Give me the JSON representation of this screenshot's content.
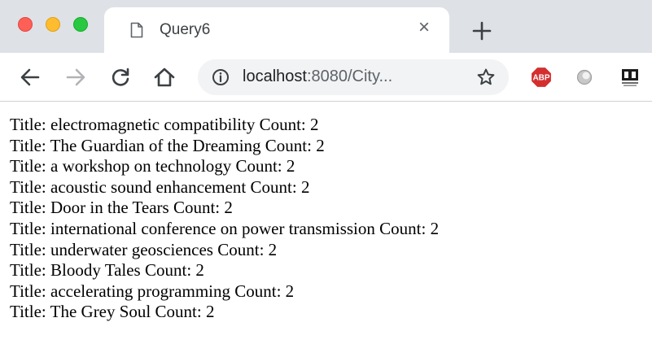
{
  "browser": {
    "tab": {
      "title": "Query6"
    },
    "address_bar": {
      "host": "localhost",
      "rest": ":8080/City..."
    },
    "colors": {
      "tabstrip": "#dee1e6",
      "close_red": "#fe5f57",
      "minimize_yellow": "#febc2e",
      "zoom_green": "#28c840",
      "abp_red": "#d32f2f"
    }
  },
  "results": [
    {
      "label": "Title:",
      "title": "electromagnetic compatibility",
      "count_label": "Count:",
      "count": "2"
    },
    {
      "label": "Title:",
      "title": "The Guardian of the Dreaming",
      "count_label": "Count:",
      "count": "2"
    },
    {
      "label": "Title:",
      "title": "a workshop on technology",
      "count_label": "Count:",
      "count": "2"
    },
    {
      "label": "Title:",
      "title": "acoustic sound enhancement",
      "count_label": "Count:",
      "count": "2"
    },
    {
      "label": "Title:",
      "title": "Door in the Tears",
      "count_label": "Count:",
      "count": "2"
    },
    {
      "label": "Title:",
      "title": "international conference on power transmission",
      "count_label": "Count:",
      "count": "2"
    },
    {
      "label": "Title:",
      "title": "underwater geosciences",
      "count_label": "Count:",
      "count": "2"
    },
    {
      "label": "Title:",
      "title": "Bloody Tales",
      "count_label": "Count:",
      "count": "2"
    },
    {
      "label": "Title:",
      "title": "accelerating programming",
      "count_label": "Count:",
      "count": "2"
    },
    {
      "label": "Title:",
      "title": "The Grey Soul",
      "count_label": "Count:",
      "count": "2"
    }
  ]
}
